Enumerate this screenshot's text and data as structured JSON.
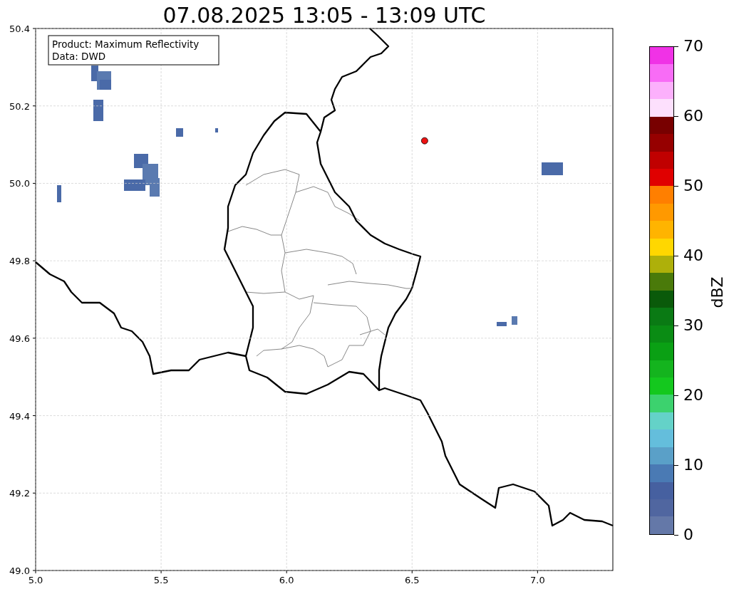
{
  "legend_box": {
    "lines": [
      "Product: Maximum Reflectivity",
      "Data: DWD"
    ]
  },
  "chart_data": {
    "type": "scatter",
    "title": "07.08.2025 13:05 - 13:09 UTC",
    "xlim": [
      5,
      7.3
    ],
    "ylim": [
      49,
      50.4
    ],
    "grid": true,
    "xticks": [
      {
        "value": 5,
        "label": "5.0"
      },
      {
        "value": 5.5,
        "label": "5.5"
      },
      {
        "value": 6,
        "label": "6.0"
      },
      {
        "value": 6.5,
        "label": "6.5"
      },
      {
        "value": 7,
        "label": "7.0"
      }
    ],
    "yticks": [
      {
        "value": 49,
        "label": "49.0"
      },
      {
        "value": 49.2,
        "label": "49.2"
      },
      {
        "value": 49.4,
        "label": "49.4"
      },
      {
        "value": 49.6,
        "label": "49.6"
      },
      {
        "value": 49.8,
        "label": "49.8"
      },
      {
        "value": 50,
        "label": "50.0"
      },
      {
        "value": 50.2,
        "label": "50.2"
      },
      {
        "value": 50.4,
        "label": "50.4"
      }
    ],
    "x": [
      6.55
    ],
    "series": [
      {
        "color": "#ee1111",
        "values": [
          50.11
        ]
      }
    ]
  },
  "colorbar": {
    "label": "dBZ",
    "ticks": [
      "70",
      "60",
      "50",
      "40",
      "30",
      "20",
      "10",
      "0"
    ],
    "bands": [
      {
        "color": "#f032e6"
      },
      {
        "color": "#f86cf6"
      },
      {
        "color": "#fcb0fc"
      },
      {
        "color": "#fde0fd"
      },
      {
        "color": "#780000"
      },
      {
        "color": "#960000"
      },
      {
        "color": "#c00000"
      },
      {
        "color": "#e00000"
      },
      {
        "color": "#ff7f00"
      },
      {
        "color": "#ff9900"
      },
      {
        "color": "#ffb400"
      },
      {
        "color": "#ffd700"
      },
      {
        "color": "#aeb00a"
      },
      {
        "color": "#4a7a0a"
      },
      {
        "color": "#0a5a0a"
      },
      {
        "color": "#0a7a14"
      },
      {
        "color": "#0a8c14"
      },
      {
        "color": "#0aa014"
      },
      {
        "color": "#14b41e"
      },
      {
        "color": "#14c81e"
      },
      {
        "color": "#3cd26e"
      },
      {
        "color": "#64d2c8"
      },
      {
        "color": "#64bedc"
      },
      {
        "color": "#5aa0c8"
      },
      {
        "color": "#4a7ab4"
      },
      {
        "color": "#4660a0"
      },
      {
        "color": "#5066a0"
      },
      {
        "color": "#6478a8"
      }
    ]
  }
}
